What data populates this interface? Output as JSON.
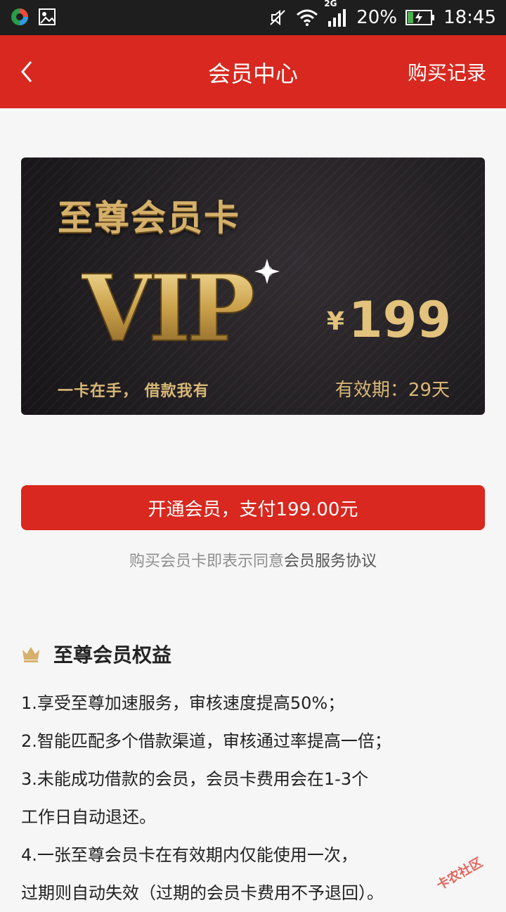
{
  "status": {
    "battery": "20%",
    "network": "2G",
    "time": "18:45"
  },
  "header": {
    "title": "会员中心",
    "right_action": "购买记录"
  },
  "card": {
    "title": "至尊会员卡",
    "vip_text": "VIP",
    "slogan": "一卡在手， 借款我有",
    "price_symbol": "¥",
    "price": "199",
    "validity": "有效期：29天"
  },
  "pay_button": "开通会员，支付199.00元",
  "agreement": {
    "prefix": "购买会员卡即表示同意",
    "link": "会员服务协议"
  },
  "benefits": {
    "title": "至尊会员权益",
    "lines": [
      "1.享受至尊加速服务，审核速度提高50%；",
      "2.智能匹配多个借款渠道，审核通过率提高一倍；",
      "3.未能成功借款的会员，会员卡费用会在1-3个",
      "工作日自动退还。",
      "4.一张至尊会员卡在有效期内仅能使用一次，",
      "过期则自动失效（过期的会员卡费用不予退回）。"
    ]
  },
  "watermark": "卡农社区",
  "colors": {
    "primary": "#d8281f",
    "gold": "#d4b06a",
    "card_bg": "#231f23"
  }
}
